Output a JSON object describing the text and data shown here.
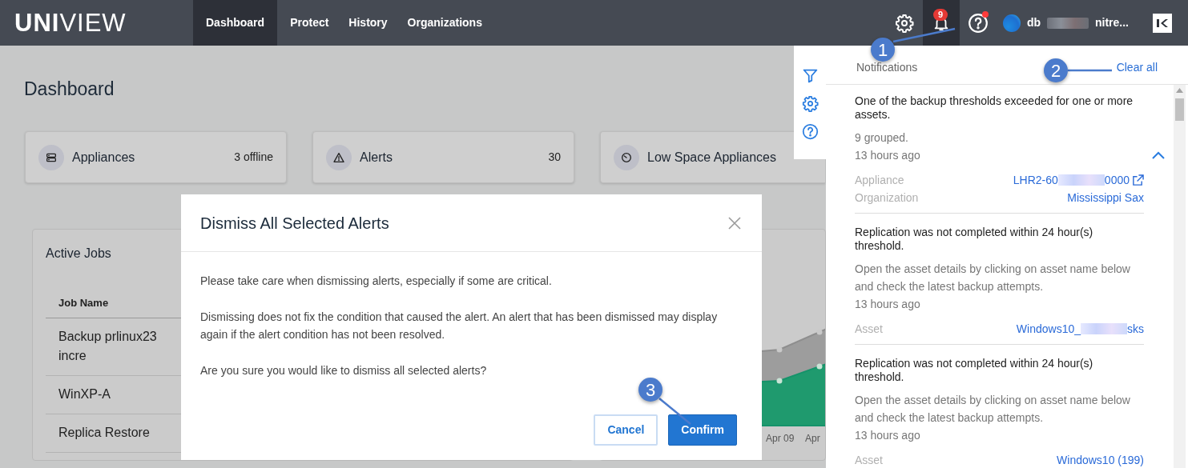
{
  "navbar": {
    "logo": "**UNI**VIEW",
    "tabs": [
      {
        "label": "Dashboard",
        "selected": true
      },
      {
        "label": "Protect",
        "selected": false
      },
      {
        "label": "History",
        "selected": false
      },
      {
        "label": "Organizations",
        "selected": false
      }
    ],
    "notifications_button": {
      "badge": "9",
      "selected": true
    },
    "help_button": {
      "unread": true
    },
    "user": {
      "name_start": "db",
      "name_end": "nitre..."
    }
  },
  "page": {
    "title": "Dashboard",
    "summary_cards": [
      {
        "kind": "appliances",
        "label": "Appliances",
        "value": "3 offline"
      },
      {
        "kind": "alerts",
        "label": "Alerts",
        "value": "30"
      },
      {
        "kind": "low-space",
        "label": "Low Space Appliances"
      }
    ],
    "active_jobs": {
      "title": "Active Jobs",
      "columns": [
        "Job Name"
      ],
      "rows": [
        "Backup prlinux23 incre",
        "WinXP-A",
        "Replica Restore"
      ]
    },
    "chart": {
      "x_labels": [
        "Apr 09",
        "Apr"
      ]
    }
  },
  "dialog": {
    "title": "Dismiss All Selected Alerts",
    "paragraphs": [
      "Please take care when dismissing alerts, especially if some are critical.",
      "Dismissing does not fix the condition that caused the alert. An alert that has been dismissed may display again if the alert condition has not been resolved.",
      "Are you sure you would like to dismiss all selected alerts?"
    ],
    "buttons": [
      {
        "label": "Cancel",
        "kind": "secondary"
      },
      {
        "label": "Confirm",
        "kind": "primary"
      }
    ]
  },
  "notifications": {
    "title": "Notifications",
    "clear_label": "Clear all",
    "items": [
      {
        "title": "One of the backup thresholds exceeded for one or more assets.",
        "detail": "9 grouped.",
        "time": "13 hours ago",
        "expanded": true,
        "fields": [
          {
            "label": "Appliance",
            "value": "LHR2-60",
            "value_end": "0000",
            "external": true
          },
          {
            "label": "Organization",
            "value": "Mississippi Sax"
          }
        ]
      },
      {
        "title": "Replication was not completed within 24 hour(s) threshold.",
        "detail": "Open the asset details by clicking on asset name below and check the latest backup attempts.",
        "time": "13 hours ago",
        "fields": [
          {
            "label": "Asset",
            "value": "Windows10_",
            "value_end": "sks"
          }
        ]
      },
      {
        "title": "Replication was not completed within 24 hour(s) threshold.",
        "detail": "Open the asset details by clicking on asset name below and check the latest backup attempts.",
        "time": "13 hours ago",
        "fields": [
          {
            "label": "Asset",
            "value": "Windows10 (199)"
          }
        ]
      }
    ]
  },
  "callouts": [
    {
      "number": "1"
    },
    {
      "number": "2"
    },
    {
      "number": "3"
    }
  ]
}
